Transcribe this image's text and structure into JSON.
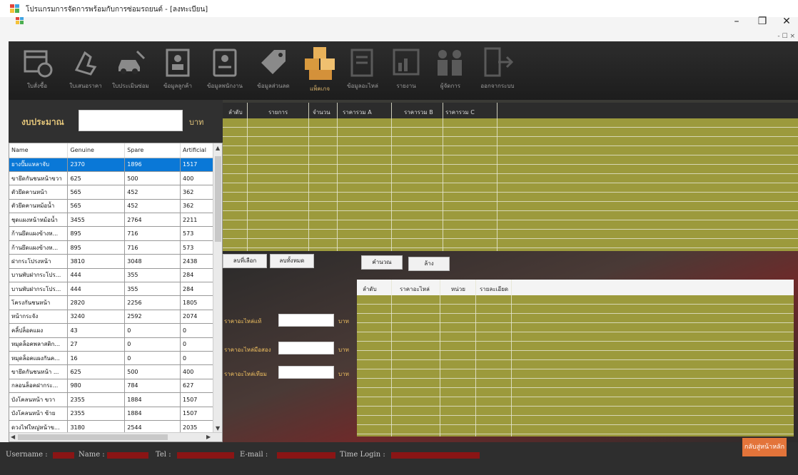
{
  "window": {
    "title": "โปรแกรมการจัดการพร้อมกับการซ่อมรถยนต์ - [ลงทะเบียน]",
    "minimize": "–",
    "restore": "❐",
    "close": "✕",
    "mdi_controls": "- ☐ ×"
  },
  "toolbar": {
    "items": [
      {
        "label": "ใบสั่งซื้อ",
        "icon": "calendar-clock-icon"
      },
      {
        "label": "ใบเสนอราคา",
        "icon": "handshake-icon"
      },
      {
        "label": "ใบประเมินซ่อม",
        "icon": "car-repair-icon"
      },
      {
        "label": "ข้อมูลลูกค้า",
        "icon": "customer-card-icon"
      },
      {
        "label": "ข้อมูลพนักงาน",
        "icon": "employee-card-icon"
      },
      {
        "label": "ข้อมูลส่วนลด",
        "icon": "sale-tag-icon"
      },
      {
        "label": "แพ็คเกจ",
        "icon": "boxes-icon"
      },
      {
        "label": "ข้อมูลอะไหล่",
        "icon": "document-list-icon"
      },
      {
        "label": "รายงาน",
        "icon": "report-chart-icon"
      },
      {
        "label": "ผู้จัดการ",
        "icon": "managers-icon"
      },
      {
        "label": "ออกจากระบบ",
        "icon": "logout-icon"
      }
    ]
  },
  "budget": {
    "label": "งบประมาณ",
    "value": "",
    "unit": "บาท"
  },
  "parts_table": {
    "columns": [
      "Name",
      "Genuine",
      "Spare",
      "Artificial"
    ],
    "rows": [
      [
        "ยางปั๊มแหลาจับ",
        "2370",
        "1896",
        "1517"
      ],
      [
        "ขายึดกันชนหน้าขวา",
        "625",
        "500",
        "400"
      ],
      [
        "ตัวยึดคานหน้า",
        "565",
        "452",
        "362"
      ],
      [
        "ตัวยึดคานหม้อน้ำ",
        "565",
        "452",
        "362"
      ],
      [
        "ชุดแผงหน้าหม้อน้ำ",
        "3455",
        "2764",
        "2211"
      ],
      [
        "ก้านยึดแผงข้างห...",
        "895",
        "716",
        "573"
      ],
      [
        "ก้านยึดแผงข้างห...",
        "895",
        "716",
        "573"
      ],
      [
        "ฝากระโปรงหน้า",
        "3810",
        "3048",
        "2438"
      ],
      [
        "บานพับฝากระโปร...",
        "444",
        "355",
        "284"
      ],
      [
        "บานพับฝากระโปร...",
        "444",
        "355",
        "284"
      ],
      [
        "โครงกันชนหน้า",
        "2820",
        "2256",
        "1805"
      ],
      [
        "หน้ากระจัง",
        "3240",
        "2592",
        "2074"
      ],
      [
        "คลิ้ปล็อคแผง",
        "43",
        "0",
        "0"
      ],
      [
        "หมุดล็อคพลาสติก...",
        "27",
        "0",
        "0"
      ],
      [
        "หมุดล็อคแผงกันค...",
        "16",
        "0",
        "0"
      ],
      [
        "ขายึดกันชนหน้า ...",
        "625",
        "500",
        "400"
      ],
      [
        "กลอนล็อคฝากระ...",
        "980",
        "784",
        "627"
      ],
      [
        "บังโคลนหน้า ขวา",
        "2355",
        "1884",
        "1507"
      ],
      [
        "บังโคลนหน้า ซ้าย",
        "2355",
        "1884",
        "1507"
      ],
      [
        "ดวงไฟใหญ่หน้าข...",
        "3180",
        "2544",
        "2035"
      ]
    ],
    "scroll_up": "▲",
    "scroll_down": "▼",
    "scroll_left": "◀",
    "scroll_right": "▶"
  },
  "order_table": {
    "columns": [
      "ลำดับ",
      "รายการ",
      "จำนวน",
      "ราคารวม A",
      "ราคารวม B",
      "ราคารวม C"
    ]
  },
  "buttons": {
    "delete_selected": "ลบที่เลือก",
    "delete_all": "ลบทั้งหมด",
    "calculate": "คำนวณ",
    "clear": "ล้าง",
    "back_main": "กลับสู่หน้าหลัก"
  },
  "price_fields": [
    {
      "label": "ราคาอะไหล่แท้",
      "value": "",
      "unit": "บาท"
    },
    {
      "label": "ราคาอะไหล่มือสอง",
      "value": "",
      "unit": "บาท"
    },
    {
      "label": "ราคาอะไหล่เทียม",
      "value": "",
      "unit": "บาท"
    }
  ],
  "detail_table": {
    "columns": [
      "ลำดับ",
      "ราคาอะไหล่",
      "หน่วย",
      "รายละเอียด"
    ]
  },
  "status": {
    "username_label": "Username :",
    "name_label": "Name :",
    "tel_label": "Tel :",
    "email_label": "E-mail :",
    "time_label": "Time Login :"
  },
  "colors": {
    "grid_olive": "#9c9a3c",
    "selected_row": "#0a78d7",
    "back_button": "#e3743a",
    "label_gold": "#f0c060"
  }
}
